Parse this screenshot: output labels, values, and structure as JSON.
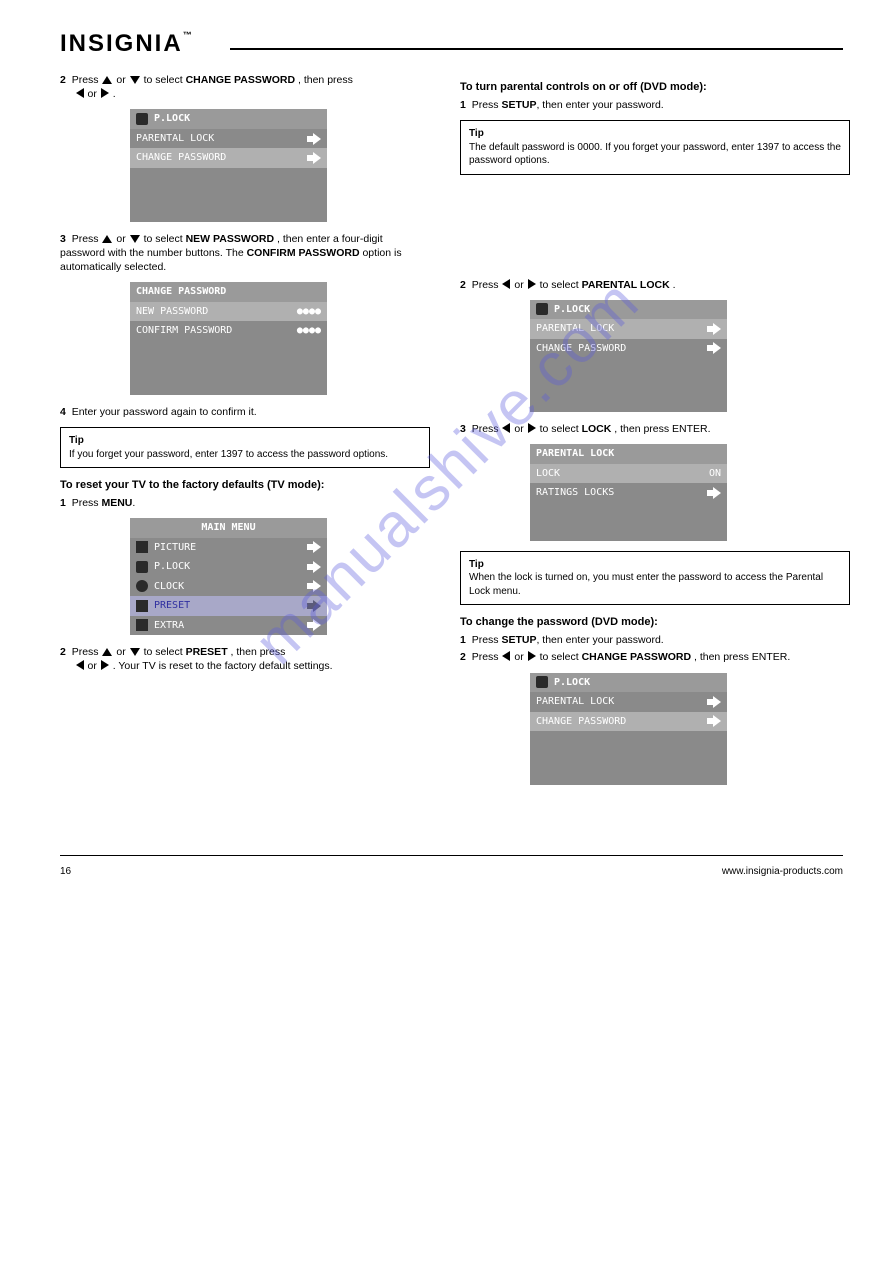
{
  "logo": "INSIGNIA",
  "logo_tm": "™",
  "watermark": "manualshive.com",
  "page_number": "16",
  "footer_url": "www.insignia-products.com",
  "left": {
    "step2_a": "Press ",
    "step2_b": " or ",
    "step2_c": " to select ",
    "step2_d": "CHANGE PASSWORD",
    "step2_e": ", then press ",
    "step2_f": " or ",
    "step2_g": ".",
    "step2_num": "2",
    "step3_a": "Press ",
    "step3_b": " or ",
    "step3_c": " to select ",
    "step3_d": "NEW PASSWORD",
    "step3_e": ", then enter a four-digit password with the number buttons. The ",
    "step3_f": "CONFIRM PASSWORD",
    "step3_g": " option is automatically selected.",
    "step3_num": "3",
    "step4_a": "Enter your password again to confirm it.",
    "step4_num": "4",
    "tip1_label": "Tip",
    "tip1_body": "If you forget your password, enter 1397 to access the password options.",
    "heading1": "To reset your TV to the factory defaults (TV mode):",
    "s1_num": "1",
    "s1": "Press ",
    "s1b": "MENU",
    "s1c": ".",
    "s2_num": "2",
    "s2_a": "Press ",
    "s2_b": " or ",
    "s2_c": " to select ",
    "s2_d": "PRESET",
    "s2_e": ", then press ",
    "s2_f": " or ",
    "s2_g": ". Your TV is reset to the factory default settings."
  },
  "right": {
    "heading2": "To turn parental controls on or off (DVD mode):",
    "r1_num": "1",
    "r1_a": "Press ",
    "r1_b": "SETUP",
    "r1_c": ", then enter your password.",
    "tip2_label": "Tip",
    "tip2_body": "The default password is 0000. If you forget your password, enter 1397 to access the password options.",
    "r2_num": "2",
    "r2_a": "Press ",
    "r2_b": " or ",
    "r2_c": " to select ",
    "r2_d": "PARENTAL LOCK",
    "r2_e": ".",
    "r3_num": "3",
    "r3_a": "Press ",
    "r3_b": " or ",
    "r3_c": " to select ",
    "r3_d": "LOCK",
    "r3_e": ", then press ENTER.",
    "tip3_label": "Tip",
    "tip3_body": "When the lock is turned on, you must enter the password to access the Parental Lock menu.",
    "heading3": "To change the password (DVD mode):",
    "d1_num": "1",
    "d1_a": "Press ",
    "d1_b": "SETUP",
    "d1_c": ", then enter your password.",
    "d2_num": "2",
    "d2_a": "Press ",
    "d2_b": " or ",
    "d2_c": " to select ",
    "d2_d": "CHANGE PASSWORD",
    "d2_e": ", then press ENTER."
  },
  "osd": {
    "plock_title": "P.LOCK",
    "parental_lock": "PARENTAL LOCK",
    "change_password": "CHANGE PASSWORD",
    "change_password_title": "CHANGE PASSWORD",
    "new_password": "NEW PASSWORD",
    "confirm_password": "CONFIRM PASSWORD",
    "dots": "●●●●",
    "main_menu": "MAIN MENU",
    "picture": "PICTURE",
    "plock": "P.LOCK",
    "clock": "CLOCK",
    "preset": "PRESET",
    "extra": "EXTRA",
    "parental_lock_title": "PARENTAL LOCK",
    "lock": "LOCK",
    "on": "ON",
    "ratings_locks": "RATINGS LOCKS"
  }
}
